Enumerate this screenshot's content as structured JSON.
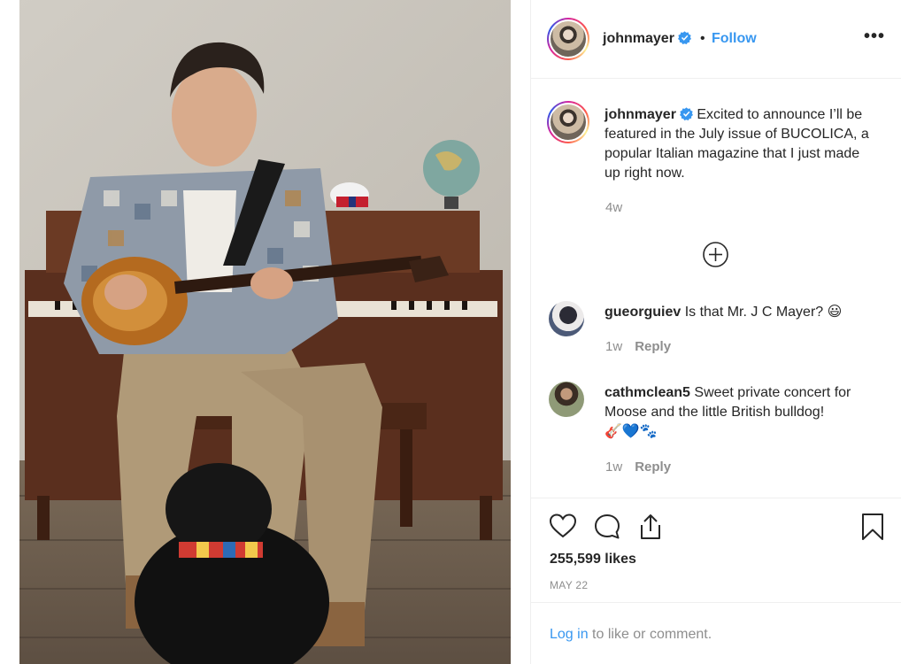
{
  "post": {
    "image_alt": "Man playing guitar seated in front of a piano with a black dog",
    "author": "johnmayer",
    "follow_separator": "•",
    "follow_label": "Follow",
    "more_label": "•••"
  },
  "caption": {
    "username": "johnmayer",
    "text": "Excited to announce I’ll be featured in the July issue of BUCOLICA, a popular Italian magazine that I just made up right now.",
    "time": "4w"
  },
  "comments": [
    {
      "username": "gueorguiev",
      "text": "Is that Mr. J C Mayer?",
      "emoji": "😃",
      "time": "1w",
      "reply_label": "Reply"
    },
    {
      "username": "cathmclean5",
      "text": "Sweet private concert for Moose and the little British bulldog!",
      "emoji": "🎸💙🐾",
      "time": "1w",
      "reply_label": "Reply"
    }
  ],
  "stats": {
    "likes": "255,599 likes",
    "date": "MAY 22"
  },
  "footer": {
    "login_label": "Log in",
    "rest": " to like or comment."
  },
  "colors": {
    "link": "#3897f0",
    "secondary": "#8e8e8e",
    "primary": "#262626",
    "verified": "#3897f0"
  },
  "icons": {
    "like": "heart-icon",
    "comment": "comment-icon",
    "share": "share-icon",
    "save": "bookmark-icon",
    "verified": "verified-badge-icon",
    "load_more": "plus-circle-icon"
  }
}
